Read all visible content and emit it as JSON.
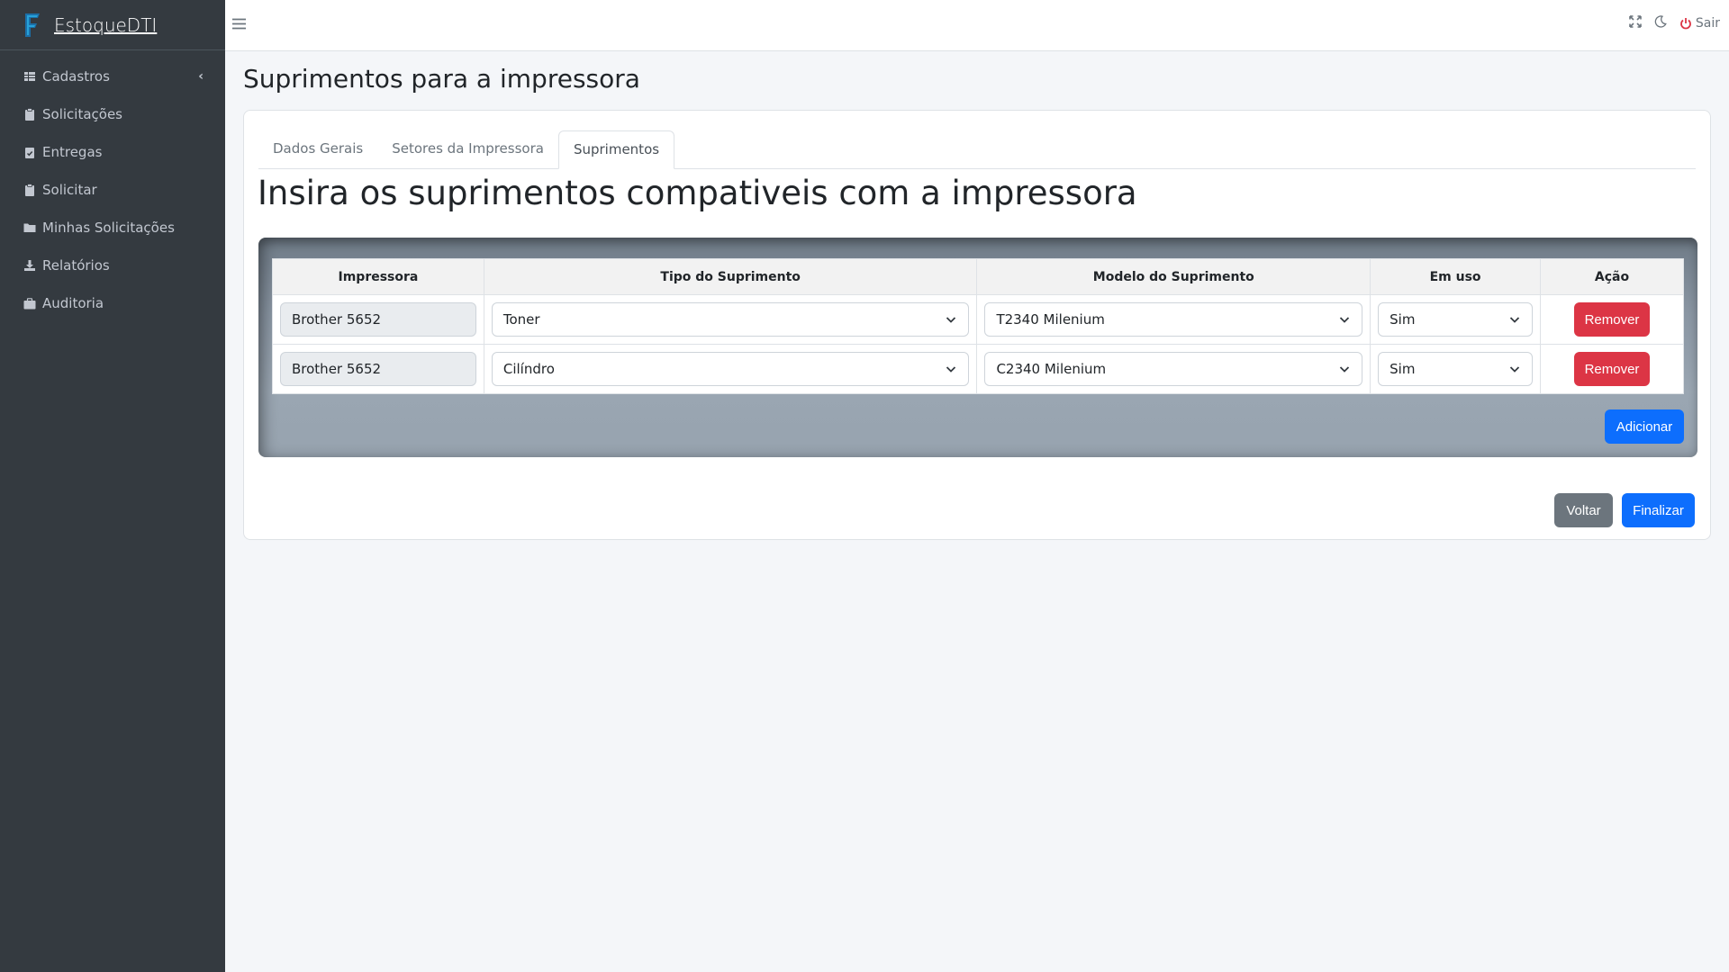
{
  "app": {
    "brand": "EstoqueDTI"
  },
  "sidebar": {
    "items": [
      {
        "label": "Cadastros",
        "icon": "table-icon"
      },
      {
        "label": "Solicitações",
        "icon": "clipboard-icon"
      },
      {
        "label": "Entregas",
        "icon": "clipboard-check-icon"
      },
      {
        "label": "Solicitar",
        "icon": "clipboard-icon"
      },
      {
        "label": "Minhas Solicitações",
        "icon": "folder-icon"
      },
      {
        "label": "Relatórios",
        "icon": "download-icon"
      },
      {
        "label": "Auditoria",
        "icon": "briefcase-icon"
      }
    ]
  },
  "topbar": {
    "logout_label": "Sair"
  },
  "page": {
    "title": "Suprimentos para a impressora",
    "tabs": [
      "Dados Gerais",
      "Setores da Impressora",
      "Suprimentos"
    ],
    "active_tab": "Suprimentos",
    "subtitle": "Insira os suprimentos compativeis com a impressora"
  },
  "table": {
    "headers": [
      "Impressora",
      "Tipo do Suprimento",
      "Modelo do Suprimento",
      "Em uso",
      "Ação"
    ],
    "rows": [
      {
        "impressora": "Brother 5652",
        "tipo": "Toner",
        "modelo": "T2340 Milenium",
        "em_uso": "Sim",
        "acao": "Remover"
      },
      {
        "impressora": "Brother 5652",
        "tipo": "Cilíndro",
        "modelo": "C2340 Milenium",
        "em_uso": "Sim",
        "acao": "Remover"
      }
    ]
  },
  "buttons": {
    "add": "Adicionar",
    "back": "Voltar",
    "finish": "Finalizar"
  },
  "colors": {
    "sidebar": "#343a40",
    "primary": "#0d6efd",
    "danger": "#dc3545",
    "secondary": "#6c757d"
  }
}
